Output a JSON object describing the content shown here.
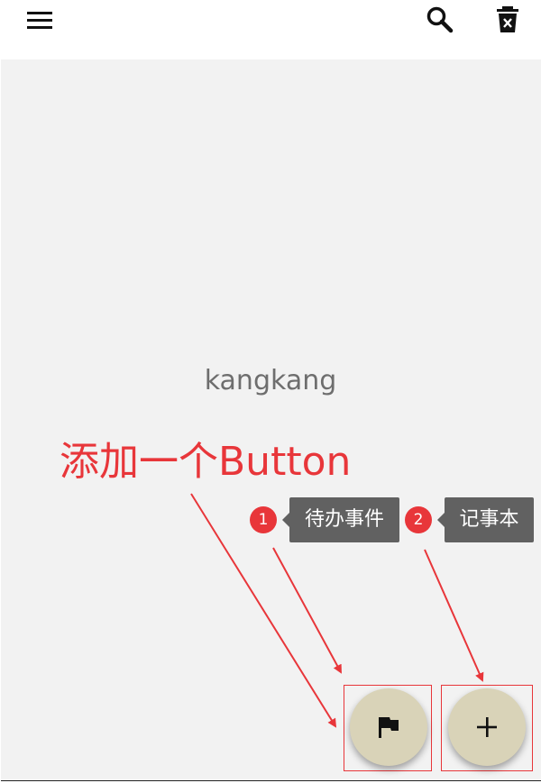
{
  "toolbar": {
    "menu_icon": "menu-icon",
    "search_icon": "search-icon",
    "delete_icon": "delete-sweep-icon"
  },
  "content": {
    "center_text": "kangkang"
  },
  "annotation": {
    "title": "添加一个Button",
    "color": "#e8363a"
  },
  "fab_menu": [
    {
      "badge": "1",
      "label": "待办事件",
      "icon": "flag-icon"
    },
    {
      "badge": "2",
      "label": "记事本",
      "icon": "plus-icon"
    }
  ],
  "colors": {
    "fab_background": "#d9d3b8",
    "tooltip_background": "#616161",
    "content_background": "#f2f2f2"
  }
}
